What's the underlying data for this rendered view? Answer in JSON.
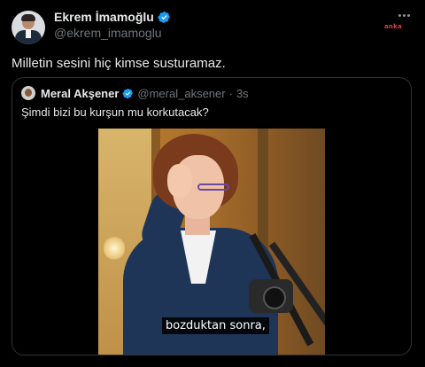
{
  "tweet": {
    "author_name": "Ekrem İmamoğlu",
    "handle": "@ekrem_imamoglu",
    "text": "Milletin sesini hiç kimse susturamaz.",
    "more_icon": "more-horizontal-icon",
    "verified_icon": "verified-badge-icon",
    "watermark": "anka"
  },
  "quote": {
    "author_name": "Meral Akşener",
    "handle": "@meral_aksener",
    "separator": "·",
    "time": "3s",
    "text": "Şimdi bizi bu kurşun mu korkutacak?",
    "video_subtitle": "bozduktan sonra,"
  },
  "colors": {
    "background": "#000000",
    "text": "#e7e9ea",
    "secondary_text": "#71767b",
    "border": "#2f3336",
    "verified": "#1d9bf0"
  }
}
